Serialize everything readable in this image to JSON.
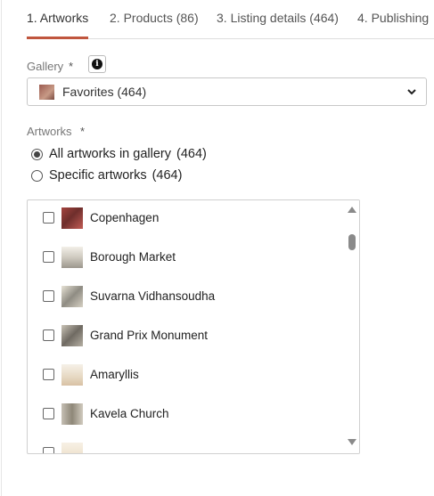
{
  "tabs": [
    {
      "label": "1. Artworks",
      "active": true
    },
    {
      "label": "2. Products (86)",
      "active": false
    },
    {
      "label": "3. Listing details (464)",
      "active": false
    },
    {
      "label": "4. Publishing",
      "active": false
    }
  ],
  "gallery": {
    "label": "Gallery",
    "required_mark": "*",
    "info_icon": "info-icon",
    "selected": "Favorites (464)"
  },
  "artworks": {
    "label": "Artworks",
    "required_mark": "*",
    "options": [
      {
        "label": "All artworks in gallery",
        "count": "(464)",
        "checked": true
      },
      {
        "label": "Specific artworks",
        "count": "(464)",
        "checked": false
      }
    ],
    "items": [
      {
        "name": "Copenhagen",
        "checked": false
      },
      {
        "name": "Borough Market",
        "checked": false
      },
      {
        "name": "Suvarna Vidhansoudha",
        "checked": false
      },
      {
        "name": "Grand Prix Monument",
        "checked": false
      },
      {
        "name": "Amaryllis",
        "checked": false
      },
      {
        "name": "Kavela Church",
        "checked": false
      },
      {
        "name": "",
        "checked": false
      }
    ]
  },
  "colors": {
    "accent": "#c0563e",
    "text": "#333333",
    "muted": "#777777",
    "border": "#c8c8c8"
  }
}
